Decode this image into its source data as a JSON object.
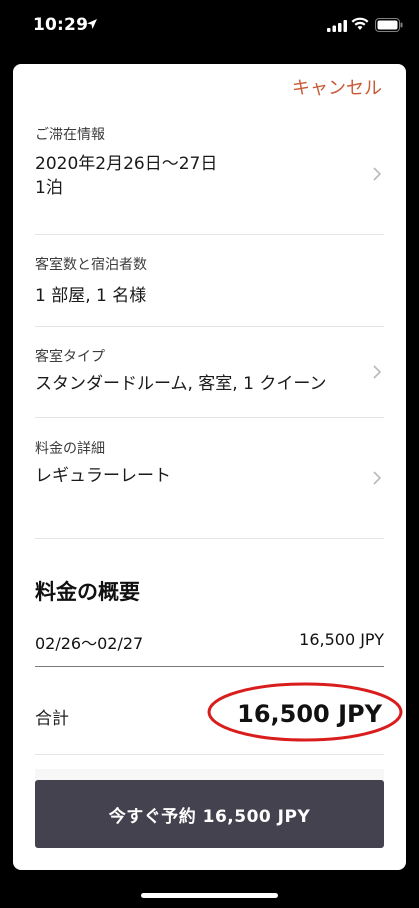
{
  "status": {
    "time": "10:29"
  },
  "header": {
    "cancel_label": "キャンセル"
  },
  "stay": {
    "label": "ご滞在情報",
    "dates": "2020年2月26日〜27日",
    "nights": "1泊"
  },
  "rooms": {
    "label": "客室数と宿泊者数",
    "value": "1 部屋, 1 名様"
  },
  "room_type": {
    "label": "客室タイプ",
    "value": "スタンダードルーム, 客室, 1 クイーン"
  },
  "rate": {
    "label": "料金の詳細",
    "value": "レギュラーレート"
  },
  "summary": {
    "title": "料金の概要",
    "period": "02/26〜02/27",
    "period_amount": "16,500 JPY",
    "total_label": "合計",
    "total_amount": "16,500 JPY"
  },
  "cta": {
    "label": "今すぐ予約 16,500 JPY"
  },
  "colors": {
    "accent": "#c85a36",
    "button": "#45424f",
    "highlight": "#d91c1c"
  }
}
